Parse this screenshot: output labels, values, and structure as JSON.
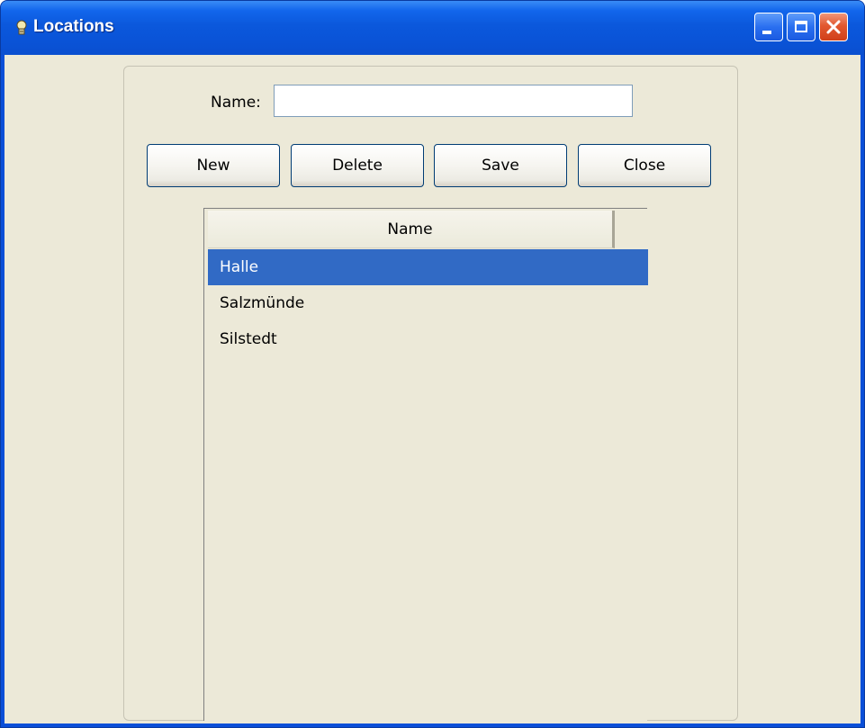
{
  "window": {
    "title": "Locations",
    "controls": {
      "minimize": "minimize",
      "maximize": "maximize",
      "close": "close"
    }
  },
  "form": {
    "name_label": "Name:",
    "name_value": "",
    "name_placeholder": ""
  },
  "buttons": {
    "new": "New",
    "delete": "Delete",
    "save": "Save",
    "close": "Close"
  },
  "table": {
    "columns": [
      "Name"
    ],
    "rows": [
      {
        "name": "Halle",
        "selected": true
      },
      {
        "name": "Salzmünde",
        "selected": false
      },
      {
        "name": "Silstedt",
        "selected": false
      }
    ]
  },
  "colors": {
    "titlebar": "#0a54d8",
    "selection": "#316ac5",
    "background": "#ece9d8"
  },
  "icons": {
    "app": "app-icon",
    "minimize": "minimize-icon",
    "maximize": "maximize-icon",
    "close": "close-icon"
  }
}
